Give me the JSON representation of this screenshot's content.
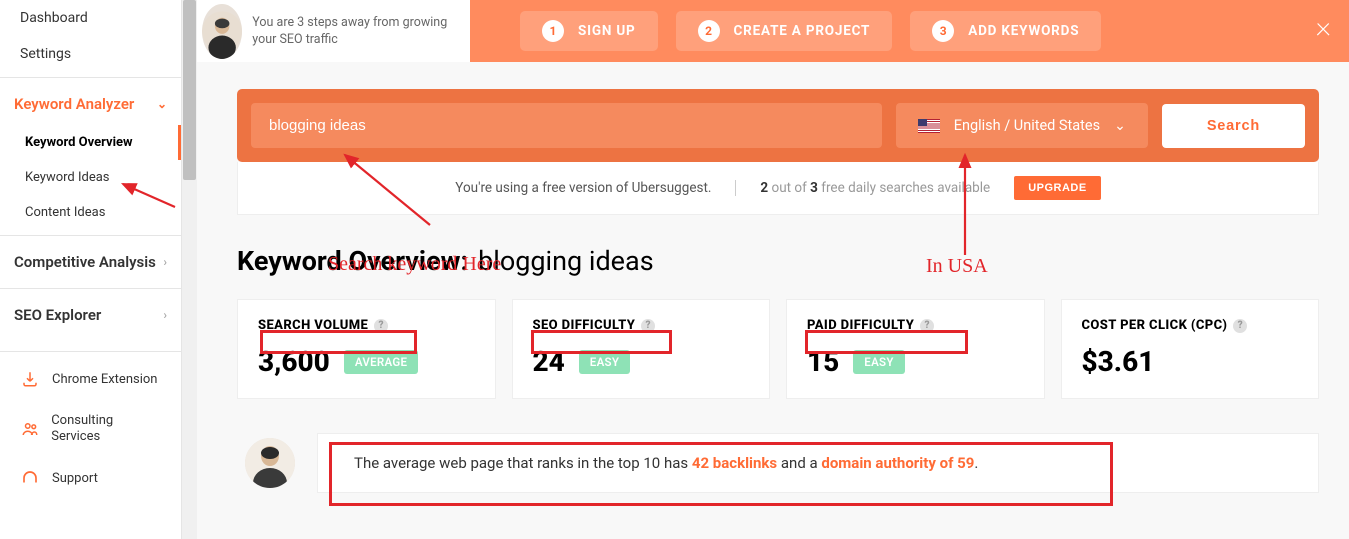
{
  "sidebar": {
    "items_top": [
      "Dashboard",
      "Settings"
    ],
    "group_analyzer": {
      "title": "Keyword Analyzer",
      "subs": [
        "Keyword Overview",
        "Keyword Ideas",
        "Content Ideas"
      ]
    },
    "group_competitive": "Competitive Analysis",
    "group_seo": "SEO Explorer",
    "links": [
      {
        "label": "Chrome Extension"
      },
      {
        "label": "Consulting Services"
      },
      {
        "label": "Support"
      }
    ]
  },
  "banner": {
    "text": "You are 3 steps away from growing your SEO traffic",
    "steps": [
      {
        "n": "1",
        "label": "SIGN UP"
      },
      {
        "n": "2",
        "label": "CREATE A PROJECT"
      },
      {
        "n": "3",
        "label": "ADD KEYWORDS"
      }
    ]
  },
  "search": {
    "value": "blogging ideas",
    "locale": "English / United States",
    "btn": "Search"
  },
  "freebar": {
    "text1": "You're using a free version of Ubersuggest.",
    "count_used": "2",
    "count_mid": " out of ",
    "count_total": "3",
    "count_suffix": " free daily searches available",
    "upgrade": "UPGRADE"
  },
  "title": {
    "prefix": "Keyword Overview:",
    "kw": "blogging ideas"
  },
  "metrics": [
    {
      "label": "SEARCH VOLUME",
      "value": "3,600",
      "badge": "AVERAGE",
      "badge_cls": "average"
    },
    {
      "label": "SEO DIFFICULTY",
      "value": "24",
      "badge": "EASY",
      "badge_cls": "easy"
    },
    {
      "label": "PAID DIFFICULTY",
      "value": "15",
      "badge": "EASY",
      "badge_cls": "easy"
    },
    {
      "label": "COST PER CLICK (CPC)",
      "value": "$3.61",
      "badge": "",
      "badge_cls": ""
    }
  ],
  "insight": {
    "prefix": "The average web page that ranks in the top 10 has ",
    "hl1": "42 backlinks",
    "mid": " and a ",
    "hl2": "domain authority of 59",
    "suffix": "."
  },
  "annotations": {
    "a1": "Search keyword Here",
    "a2": "In USA"
  }
}
